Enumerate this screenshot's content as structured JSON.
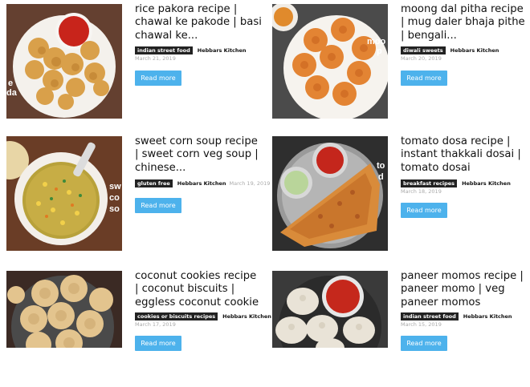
{
  "posts": [
    {
      "title": "rice pakora recipe | chawal ke pakode | basi chawal ke...",
      "category": "indian street food",
      "author": "Hebbars Kitchen",
      "date": "March 21, 2019",
      "button": "Read more",
      "overlay": "e\nda"
    },
    {
      "title": "moong dal pitha recipe | mug daler bhaja pithe | bengali...",
      "category": "diwali sweets",
      "author": "Hebbars Kitchen",
      "date": "March 20, 2019",
      "button": "Read more",
      "overlay": "moo\np"
    },
    {
      "title": "sweet corn soup recipe | sweet corn veg soup | chinese...",
      "category": "gluten free",
      "author": "Hebbars Kitchen",
      "date": "March 19, 2019",
      "button": "Read more",
      "overlay": "sw\nco\nso"
    },
    {
      "title": "tomato dosa recipe | instant thakkali dosai | tomato dosai",
      "category": "breakfast recipes",
      "author": "Hebbars Kitchen",
      "date": "March 18, 2019",
      "button": "Read more",
      "overlay": "to\nd"
    },
    {
      "title": "coconut cookies recipe | coconut biscuits | eggless coconut cookie",
      "category": "cookies or biscuits recipes",
      "author": "Hebbars Kitchen",
      "date": "March 17, 2019",
      "button": "Read more",
      "overlay": ""
    },
    {
      "title": "paneer momos recipe | paneer momo | veg paneer momos",
      "category": "indian street food",
      "author": "Hebbars Kitchen",
      "date": "March 15, 2019",
      "button": "Read more",
      "overlay": ""
    }
  ]
}
